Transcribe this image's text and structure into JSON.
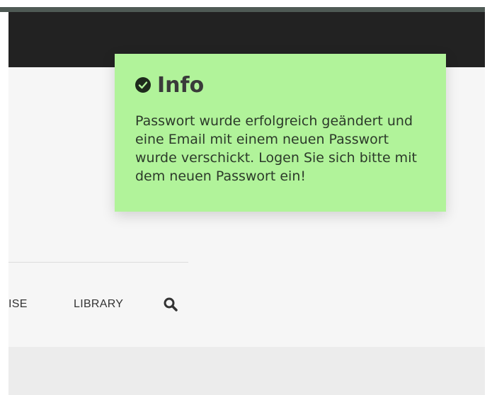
{
  "header": {
    "background_color": "#222222"
  },
  "navigation": {
    "items": [
      {
        "label": "ISE"
      },
      {
        "label": "LIBRARY"
      }
    ],
    "search_icon": "search-icon"
  },
  "notification": {
    "type": "success",
    "icon": "check-circle-icon",
    "title": "Info",
    "message": "Passwort wurde erfolgreich geändert und eine Email mit einem neuen Passwort wurde verschickt. Logen Sie sich bitte mit dem neuen Passwort ein!",
    "background_color": "#b1f39a"
  }
}
